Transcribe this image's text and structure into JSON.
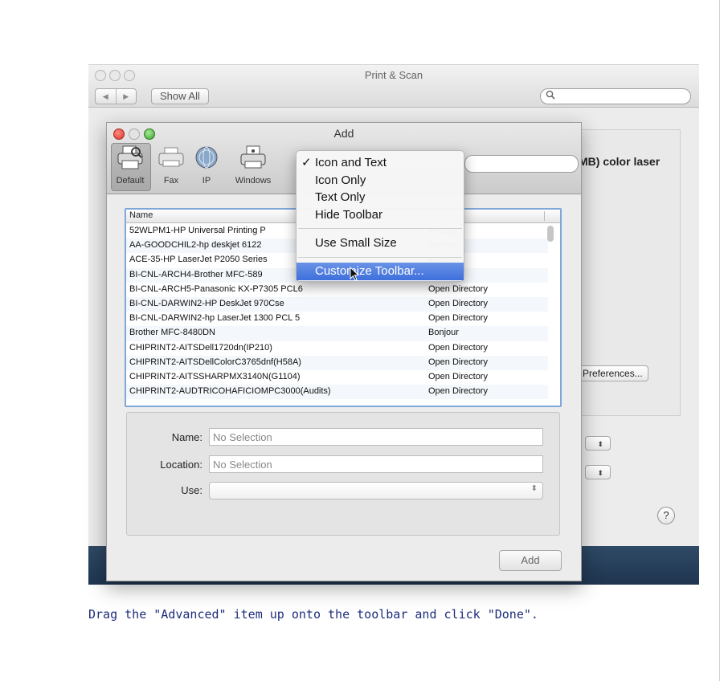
{
  "print_scan": {
    "title": "Print & Scan",
    "nav_back": "◀",
    "nav_forward": "▶",
    "show_all": "Show All",
    "search_icon": "magnifier-icon",
    "printer_title": "MB) color laser",
    "preferences_btn": "Preferences...",
    "help": "?"
  },
  "add_window": {
    "title": "Add",
    "toolbar": [
      {
        "label": "Default",
        "icon": "printer-icon"
      },
      {
        "label": "Fax",
        "icon": "fax-icon"
      },
      {
        "label": "IP",
        "icon": "globe-icon"
      },
      {
        "label": "Windows",
        "icon": "windows-printer-icon"
      }
    ],
    "list_header": {
      "name": "Name",
      "kind": ""
    },
    "rows": [
      {
        "name": "52WLPM1-HP Universal Printing P",
        "kind": "irectory"
      },
      {
        "name": "AA-GOODCHIL2-hp deskjet 6122",
        "kind": "irectory"
      },
      {
        "name": "ACE-35-HP LaserJet P2050 Series",
        "kind": "irectory"
      },
      {
        "name": "BI-CNL-ARCH4-Brother MFC-589",
        "kind": "irectory"
      },
      {
        "name": "BI-CNL-ARCH5-Panasonic KX-P7305 PCL6",
        "kind": "Open Directory"
      },
      {
        "name": "BI-CNL-DARWIN2-HP DeskJet 970Cse",
        "kind": "Open Directory"
      },
      {
        "name": "BI-CNL-DARWIN2-hp LaserJet 1300 PCL 5",
        "kind": "Open Directory"
      },
      {
        "name": "Brother MFC-8480DN",
        "kind": "Bonjour"
      },
      {
        "name": "CHIPRINT2-AITSDell1720dn(IP210)",
        "kind": "Open Directory"
      },
      {
        "name": "CHIPRINT2-AITSDellColorC3765dnf(H58A)",
        "kind": "Open Directory"
      },
      {
        "name": "CHIPRINT2-AITSSHARPMX3140N(G1104)",
        "kind": "Open Directory"
      },
      {
        "name": "CHIPRINT2-AUDTRICOHAFICIOMPC3000(Audits)",
        "kind": "Open Directory"
      }
    ],
    "details": {
      "name_label": "Name:",
      "name_value": "No Selection",
      "location_label": "Location:",
      "location_value": "No Selection",
      "use_label": "Use:",
      "use_value": ""
    },
    "add_button": "Add"
  },
  "context_menu": {
    "items": [
      {
        "label": "Icon and Text",
        "checked": "✓"
      },
      {
        "label": "Icon Only",
        "checked": ""
      },
      {
        "label": "Text Only",
        "checked": ""
      },
      {
        "label": "Hide Toolbar",
        "checked": ""
      },
      {
        "label": "Use Small Size",
        "checked": ""
      },
      {
        "label": "Customize Toolbar...",
        "checked": ""
      }
    ],
    "highlight_color": "#3e6fdb"
  },
  "caption": "Drag the \"Advanced\" item up onto the toolbar and click \"Done\"."
}
